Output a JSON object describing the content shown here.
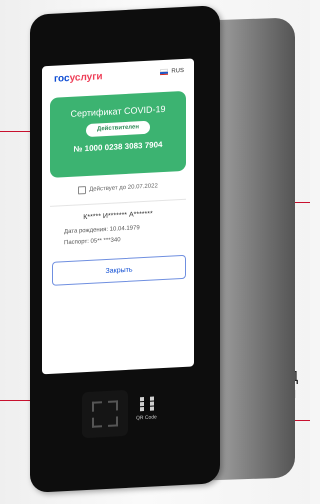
{
  "brand": {
    "logo_blue": "гос",
    "logo_red": "услуги"
  },
  "language": {
    "code": "RUS"
  },
  "certificate": {
    "title": "Сертификат COVID-19",
    "status": "Действителен",
    "number": "№ 1000 0238 3083 7904",
    "valid_until": "Действует до 20.07.2022"
  },
  "holder": {
    "name": "К***** И******* А*******",
    "dob": "Дата рождения: 10.04.1979",
    "passport": "Паспорт: 05** ***340"
  },
  "actions": {
    "close_label": "Закрыть"
  },
  "device": {
    "qr_label": "QR Code"
  },
  "callout": {
    "text": "Д\nп"
  },
  "colors": {
    "brand_blue": "#0d4cd3",
    "brand_red": "#ee3f58",
    "cert_green": "#3cb371",
    "callout_line": "#c8102e"
  }
}
